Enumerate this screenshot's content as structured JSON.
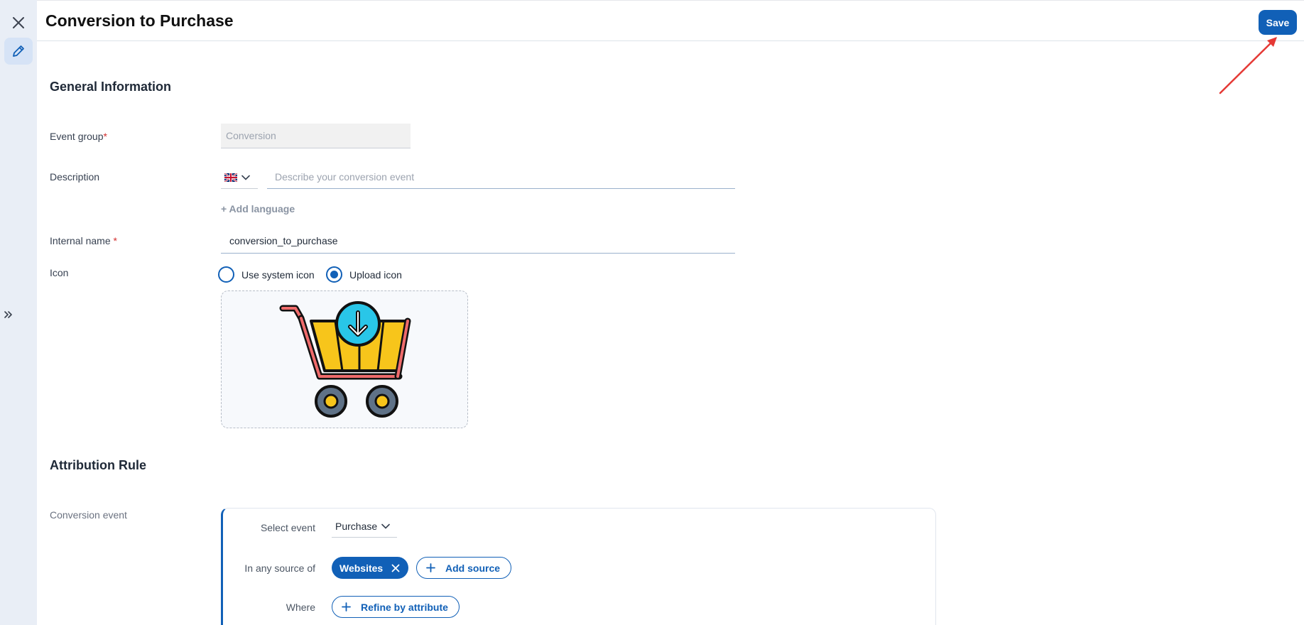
{
  "header": {
    "title": "Conversion to Purchase",
    "save_label": "Save"
  },
  "rail": {
    "close_icon": "close-icon",
    "edit_icon": "pencil-icon",
    "expand_icon": "double-chevron-right-icon"
  },
  "general": {
    "section_title": "General Information",
    "event_group": {
      "label": "Event group",
      "required_mark": "*",
      "value": "Conversion"
    },
    "description": {
      "label": "Description",
      "flag": "uk-flag-icon",
      "placeholder": "Describe your conversion event"
    },
    "add_language": "+ Add language",
    "internal_name": {
      "label": "Internal name ",
      "required_mark": "*",
      "value": "conversion_to_purchase"
    },
    "icon": {
      "label": "Icon",
      "options": [
        {
          "label": "Use system icon",
          "checked": false
        },
        {
          "label": "Upload icon",
          "checked": true
        }
      ],
      "uploaded_icon": "shopping-cart-download-icon"
    }
  },
  "attribution": {
    "section_title": "Attribution Rule",
    "conversion_event_label": "Conversion event",
    "select_event_label": "Select event",
    "selected_event": "Purchase",
    "source_label": "In any source of",
    "source_chip": "Websites",
    "add_source_label": "Add source",
    "where_label": "Where",
    "refine_label": "Refine by attribute"
  },
  "colors": {
    "primary": "#1160b7",
    "rail_bg": "#e9eef6",
    "annotation": "#e53935"
  }
}
